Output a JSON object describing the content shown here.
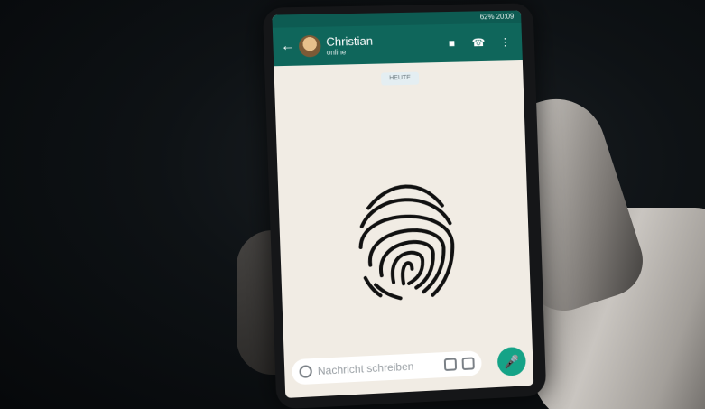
{
  "status_bar": {
    "text": "62% 20:09"
  },
  "chat": {
    "contact_name": "Christian",
    "contact_status": "online",
    "day_label": "HEUTE"
  },
  "composer": {
    "placeholder": "Nachricht schreiben"
  },
  "icons": {
    "back": "arrow-left-icon",
    "video": "video-icon",
    "phone": "phone-icon",
    "menu": "more-vert-icon",
    "emoji": "emoji-icon",
    "attach": "paperclip-icon",
    "camera": "camera-icon",
    "mic": "mic-icon"
  },
  "colors": {
    "header": "#0f665b",
    "status": "#0d5b52",
    "chat_bg": "#f1ece4",
    "mic": "#15a387"
  }
}
